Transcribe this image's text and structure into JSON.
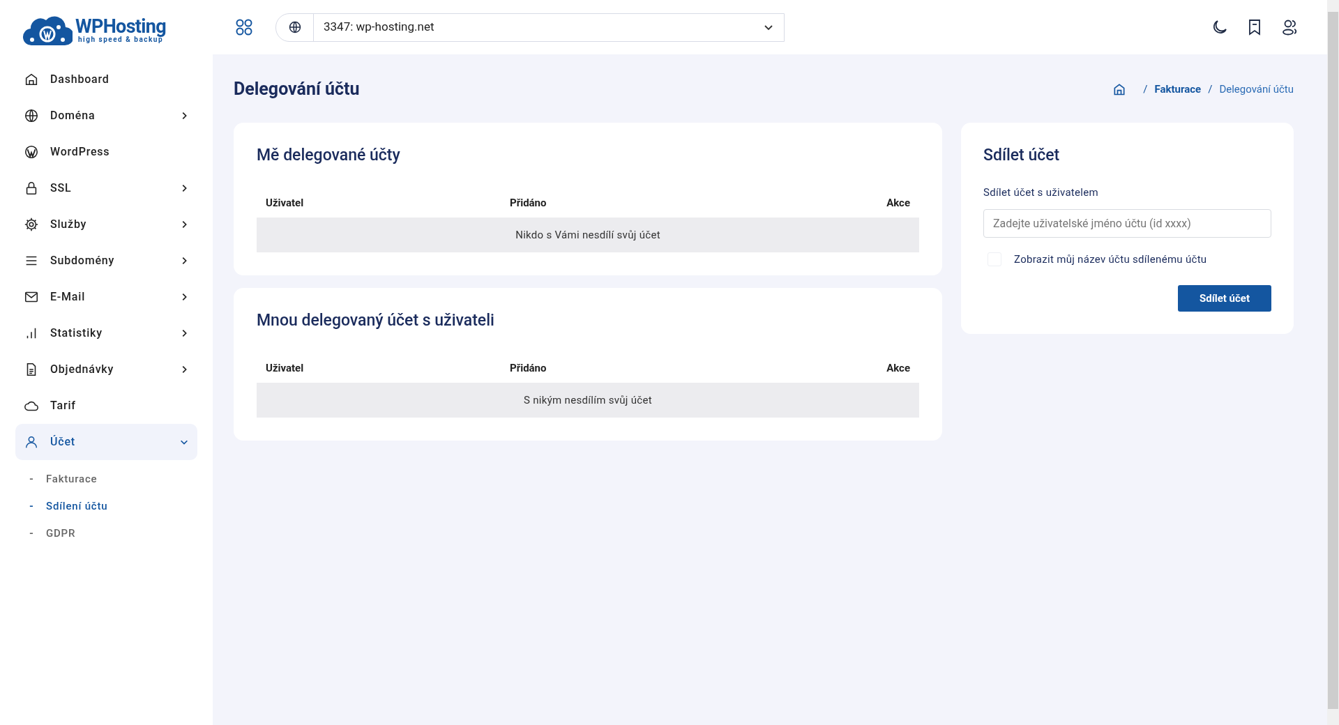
{
  "logo": {
    "name": "WPHosting",
    "tagline": "high speed & backup"
  },
  "header": {
    "account_select": {
      "value": "3347: wp-hosting.net"
    }
  },
  "sidebar": {
    "items": [
      {
        "label": "Dashboard",
        "expandable": false,
        "selected": false
      },
      {
        "label": "Doména",
        "expandable": true,
        "expanded": false,
        "selected": false
      },
      {
        "label": "WordPress",
        "expandable": false,
        "selected": false
      },
      {
        "label": "SSL",
        "expandable": true,
        "expanded": false,
        "selected": false
      },
      {
        "label": "Služby",
        "expandable": true,
        "expanded": false,
        "selected": false
      },
      {
        "label": "Subdomény",
        "expandable": true,
        "expanded": false,
        "selected": false
      },
      {
        "label": "E-Mail",
        "expandable": true,
        "expanded": false,
        "selected": false
      },
      {
        "label": "Statistiky",
        "expandable": true,
        "expanded": false,
        "selected": false
      },
      {
        "label": "Objednávky",
        "expandable": true,
        "expanded": false,
        "selected": false
      },
      {
        "label": "Tarif",
        "expandable": false,
        "selected": false
      },
      {
        "label": "Účet",
        "expandable": true,
        "expanded": true,
        "selected": true,
        "children": [
          {
            "bullet": "-",
            "label": "Fakturace",
            "selected": false
          },
          {
            "bullet": "-",
            "label": "Sdílení účtu",
            "selected": true
          },
          {
            "bullet": "-",
            "label": "GDPR",
            "selected": false
          }
        ]
      }
    ]
  },
  "page": {
    "title": "Delegování účtu",
    "breadcrumb": [
      {
        "label": "Fakturace",
        "current": false
      },
      {
        "label": "Delegování účtu",
        "current": true
      }
    ],
    "separator": "/"
  },
  "tables": [
    {
      "title": "Mě delegované účty",
      "columns": [
        "Uživatel",
        "Přidáno",
        "Akce"
      ],
      "empty_message": "Nikdo s Vámi nesdílí svůj účet"
    },
    {
      "title": "Mnou delegovaný účet s uživateli",
      "columns": [
        "Uživatel",
        "Přidáno",
        "Akce"
      ],
      "empty_message": "S nikým nesdílím svůj účet"
    }
  ],
  "share_form": {
    "title": "Sdílet účet",
    "field_label": "Sdílet účet s uživatelem",
    "placeholder": "Zadejte uživatelské jméno účtu (id xxxx)",
    "checkbox": {
      "label": "Zobrazit můj název účtu sdílenému účtu",
      "checked": false
    },
    "submit": "Sdílet účet"
  }
}
